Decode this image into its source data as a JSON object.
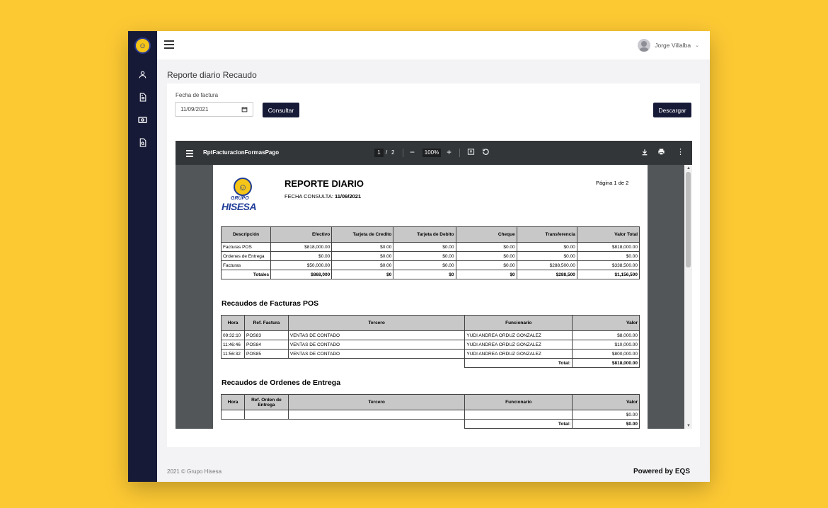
{
  "app": {
    "user_name": "Jorge Villalba",
    "page_title": "Reporte diario Recaudo",
    "footer_copyright": "2021 © Grupo Hisesa",
    "powered_by": "Powered by EQS"
  },
  "sidebar": {
    "items": [
      {
        "icon": "user-icon"
      },
      {
        "icon": "document-icon"
      },
      {
        "icon": "money-icon"
      },
      {
        "icon": "report-search-icon"
      }
    ]
  },
  "form": {
    "date_label": "Fecha de factura",
    "date_value": "11/09/2021",
    "consultar_label": "Consultar",
    "descargar_label": "Descargar"
  },
  "pdf_viewer": {
    "title": "RptFacturacionFormasPago",
    "current_page": "1",
    "page_sep": "/",
    "total_pages": "2",
    "zoom": "100%"
  },
  "report": {
    "logo_grupo": "GRUPO",
    "logo_name": "HISESA",
    "title": "REPORTE DIARIO",
    "fecha_label": "FECHA CONSULTA:",
    "fecha_value": "11/09/2021",
    "pagina": "Página 1 de 2",
    "summary": {
      "headers": [
        "Descripción",
        "Efectivo",
        "Tarjeta de Credito",
        "Tarjeta de Debito",
        "Cheque",
        "Transferencia",
        "Valor Total"
      ],
      "rows": [
        [
          "Facturas POS",
          "$818,000.00",
          "$0.00",
          "$0.00",
          "$0.00",
          "$0.00",
          "$818,000.00"
        ],
        [
          "Ordenes de Entrega",
          "$0.00",
          "$0.00",
          "$0.00",
          "$0.00",
          "$0.00",
          "$0.00"
        ],
        [
          "Facturas",
          "$50,000.00",
          "$0.00",
          "$0.00",
          "$0.00",
          "$288,500.00",
          "$338,500.00"
        ]
      ],
      "totals": [
        "Totales",
        "$868,000",
        "$0",
        "$0",
        "$0",
        "$288,500",
        "$1,156,500"
      ]
    },
    "pos": {
      "title": "Recaudos de Facturas POS",
      "headers": [
        "Hora",
        "Ref. Factura",
        "Tercero",
        "Funcionario",
        "Valor"
      ],
      "rows": [
        [
          "09:32:10",
          "POS83",
          "VENTAS DE CONTADO",
          "YUDI ANDREA ORDUZ GONZALEZ",
          "$8,000.00"
        ],
        [
          "11:46:46",
          "POS84",
          "VENTAS DE CONTADO",
          "YUDI ANDREA ORDUZ GONZALEZ",
          "$10,000.00"
        ],
        [
          "11:56:32",
          "POS85",
          "VENTAS DE CONTADO",
          "YUDI ANDREA ORDUZ GONZALEZ",
          "$800,000.00"
        ]
      ],
      "total_label": "Total:",
      "total_value": "$818,000.00"
    },
    "entrega": {
      "title": "Recaudos de Ordenes de Entrega",
      "headers": [
        "Hora",
        "Ref. Orden de Entrega",
        "Tercero",
        "Funcionario",
        "Valor"
      ],
      "row_value": "$0.00",
      "total_label": "Total:",
      "total_value": "$0.00"
    }
  }
}
